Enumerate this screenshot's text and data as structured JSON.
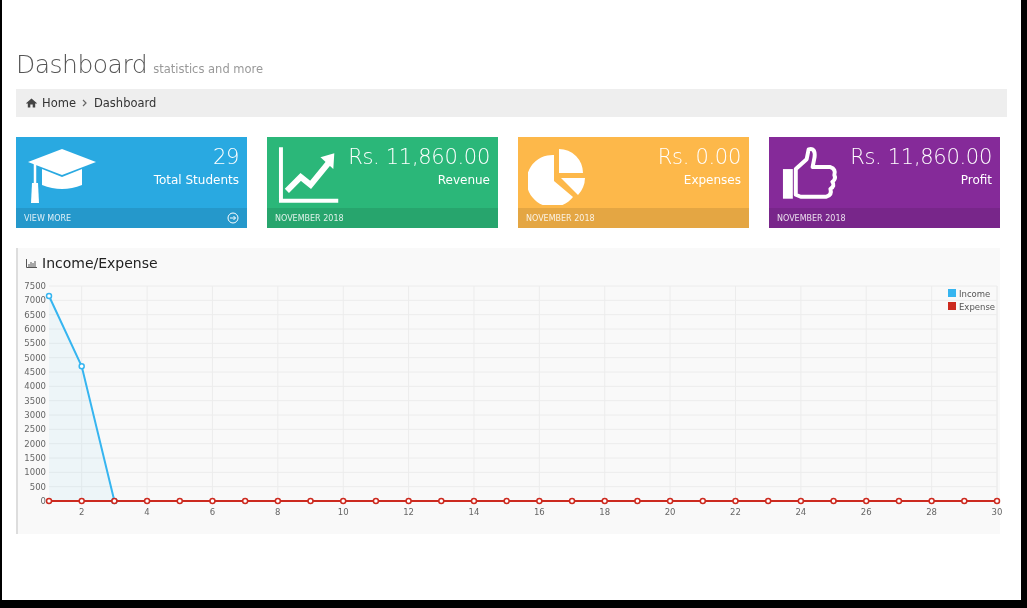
{
  "header": {
    "title": "Dashboard",
    "subtitle": "statistics and more"
  },
  "breadcrumb": [
    {
      "label": "Home",
      "kind": "home"
    },
    {
      "label": "Dashboard",
      "kind": "current"
    }
  ],
  "cards": [
    {
      "kind": "students",
      "color": "#29a9e1",
      "value": "29",
      "label": "Total Students",
      "footer": {
        "kind": "link",
        "text": "VIEW MORE"
      }
    },
    {
      "kind": "revenue",
      "color": "#2bb779",
      "value": "Rs. 11,860.00",
      "label": "Revenue",
      "footer": {
        "kind": "date",
        "text": "NOVEMBER 2018"
      }
    },
    {
      "kind": "expenses",
      "color": "#fdb84a",
      "value": "Rs. 0.00",
      "label": "Expenses",
      "footer": {
        "kind": "date",
        "text": "NOVEMBER 2018"
      }
    },
    {
      "kind": "profit",
      "color": "#852a99",
      "value": "Rs. 11,860.00",
      "label": "Profit",
      "footer": {
        "kind": "date",
        "text": "NOVEMBER 2018"
      }
    }
  ],
  "chart_panel": {
    "title": "Income/Expense",
    "chart_data": {
      "type": "line",
      "x": [
        1,
        2,
        3,
        4,
        5,
        6,
        7,
        8,
        9,
        10,
        11,
        12,
        13,
        14,
        15,
        16,
        17,
        18,
        19,
        20,
        21,
        22,
        23,
        24,
        25,
        26,
        27,
        28,
        29,
        30
      ],
      "series": [
        {
          "name": "Income",
          "color": "#36b5f0",
          "marker": "circle",
          "values": [
            7150,
            4700,
            0,
            null,
            null,
            null,
            null,
            null,
            null,
            null,
            null,
            null,
            null,
            null,
            null,
            null,
            null,
            null,
            null,
            null,
            null,
            null,
            null,
            null,
            null,
            null,
            null,
            null,
            null,
            null
          ]
        },
        {
          "name": "Expense",
          "color": "#cc2a1f",
          "marker": "circle",
          "values": [
            0,
            0,
            0,
            0,
            0,
            0,
            0,
            0,
            0,
            0,
            0,
            0,
            0,
            0,
            0,
            0,
            0,
            0,
            0,
            0,
            0,
            0,
            0,
            0,
            0,
            0,
            0,
            0,
            0,
            0
          ]
        }
      ],
      "xlim": [
        1,
        30
      ],
      "ylim": [
        0,
        7500
      ],
      "grid": true,
      "legend": true,
      "xticks": [
        2,
        4,
        6,
        8,
        10,
        12,
        14,
        16,
        18,
        20,
        22,
        24,
        26,
        28,
        30
      ],
      "yticks": [
        0,
        500,
        1000,
        1500,
        2000,
        2500,
        3000,
        3500,
        4000,
        4500,
        5000,
        5500,
        6000,
        6500,
        7000,
        7500
      ]
    }
  }
}
